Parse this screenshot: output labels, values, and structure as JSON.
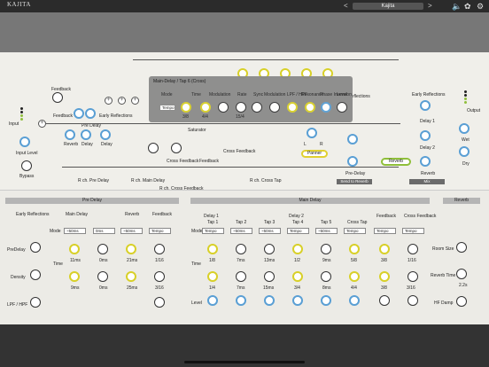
{
  "app": {
    "title": "KAJITA",
    "preset": "Kajita",
    "prev": "<",
    "next": ">"
  },
  "icons": {
    "speaker": "speaker-icon",
    "rec": "circles-icon",
    "gear": "gear-icon"
  },
  "graph": {
    "input": "Input",
    "input_level": "Input Level",
    "bypass": "Bypass",
    "output": "Output",
    "feedback": "Feedback",
    "early_reflections": "Early Reflections",
    "pre_delay": "Pre Delay",
    "reverb": "Reverb",
    "delay": "Delay",
    "saturator": "Saturator",
    "cross_feedback": "Cross Feedback",
    "r_pre": "R ch. Pre Delay",
    "r_main": "R ch. Main Delay",
    "r_cross_fb": "R ch. Cross Feedback",
    "r_cross_tap": "R ch. Cross Tap",
    "panner": "Panner",
    "pre_delay2": "Pre-Delay",
    "send_to_reverb": "Send to Reverb",
    "mix": "Mix",
    "wet": "Wet",
    "dry": "Dry",
    "delay1": "Delay 1",
    "delay2": "Delay 2",
    "l": "L",
    "r": "R",
    "reflections": "reflections"
  },
  "popup": {
    "title": "Main-Delay / Tap 6 (Cross)",
    "cols": [
      "Mode",
      "Time",
      "Modulation",
      "Rate",
      "Sync",
      "Modulation LPF / HPF",
      "Resonance",
      "Phase Inversion",
      "Level"
    ],
    "mode": "Tempo",
    "time_val": "3/8",
    "tempo": "4/4",
    "rate": "15/4",
    "sync": "Sync"
  },
  "pre_panel": {
    "title": "Pre Delay",
    "early": "Early Reflections",
    "main": "Main Delay",
    "reverb": "Reverb",
    "feedback": "Feedback",
    "mode": "Mode",
    "mode_vals": [
      "~50ms",
      "0ms",
      "~50ms",
      "Tempo"
    ],
    "predelay": "PreDelay",
    "density": "Density",
    "lpf": "LPF / HPF",
    "time": "Time",
    "vals": {
      "m1": "11ms",
      "m2": "0ms",
      "r1": "21ms",
      "f1": "1/16",
      "m3": "9ms",
      "m4": "0ms",
      "r2": "25ms",
      "f2": "3/16"
    },
    "lo": "L",
    "hi": "H"
  },
  "main_panel": {
    "title": "Main Delay",
    "delay1": "Delay 1",
    "delay2": "Delay 2",
    "taps": [
      "Tap 1",
      "Tap 2",
      "Tap 3",
      "Tap 4",
      "Tap 5",
      "Cross Tap"
    ],
    "feedback": "Feedback",
    "cross_feedback": "Cross Feedback",
    "mode": "Mode",
    "time": "Time",
    "level": "Level",
    "mode_vals": [
      "Tempo",
      "~50ms",
      "~50ms",
      "Tempo",
      "~50ms",
      "Tempo",
      "Tempo",
      "Tempo"
    ],
    "row1": [
      "1/8",
      "7ms",
      "13ms",
      "1/2",
      "9ms",
      "5/8",
      "3/8",
      "1/16"
    ],
    "row2": [
      "1/4",
      "7ms",
      "15ms",
      "3/4",
      "8ms",
      "4/4",
      "3/8",
      "3/16"
    ]
  },
  "rev_panel": {
    "title": "Reverb",
    "room": "Room Size",
    "time": "Reverb Time",
    "time_val": "2.2s",
    "damp": "HF Damp"
  }
}
